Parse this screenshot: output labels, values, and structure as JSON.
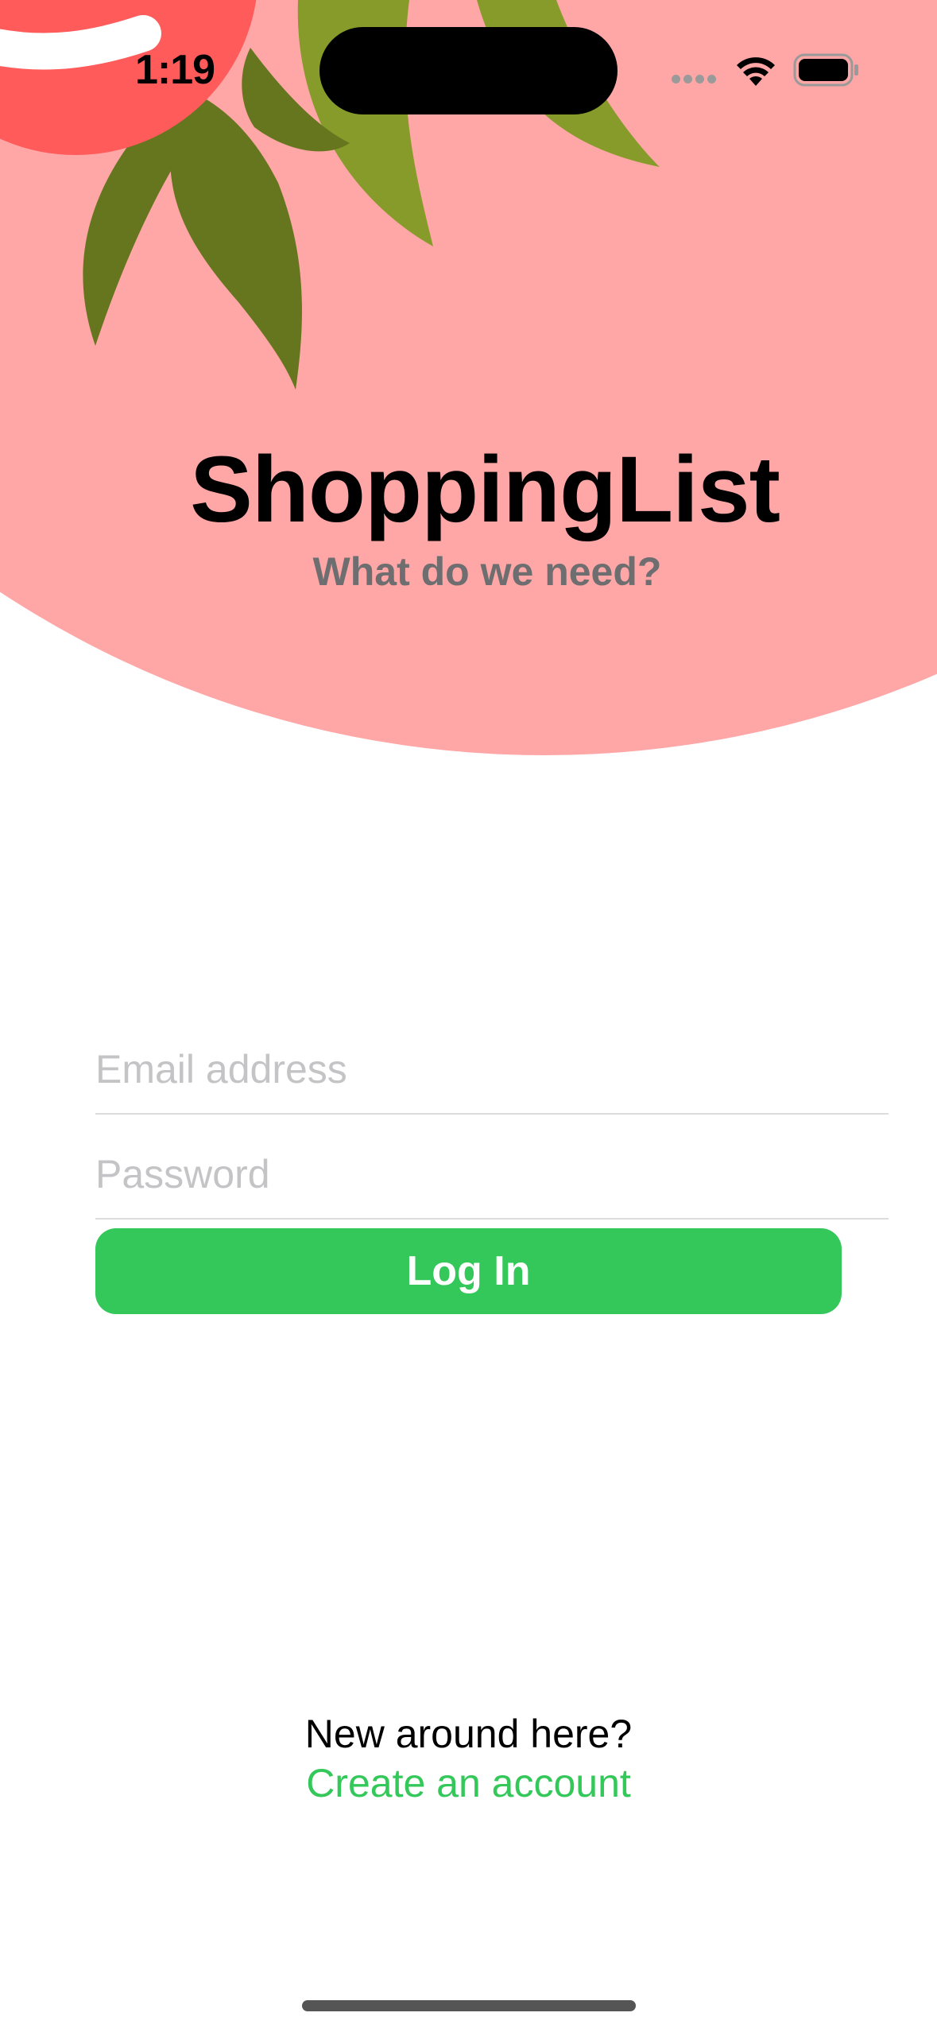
{
  "status_bar": {
    "time": "1:19",
    "icons": [
      "cellular-dots-icon",
      "wifi-icon",
      "battery-icon"
    ]
  },
  "header": {
    "title": "ShoppingList",
    "subtitle": "What do we need?"
  },
  "form": {
    "email_placeholder": "Email address",
    "email_value": "",
    "password_placeholder": "Password",
    "password_value": "",
    "login_label": "Log In"
  },
  "footer": {
    "prompt": "New around here?",
    "create_account_label": "Create an account"
  },
  "colors": {
    "accent_green": "#34c759",
    "tomato_pink": "#ffa6a6",
    "tomato_red": "#ff5b5b",
    "leaf_dark": "#66761f",
    "leaf_light": "#879b2a"
  }
}
